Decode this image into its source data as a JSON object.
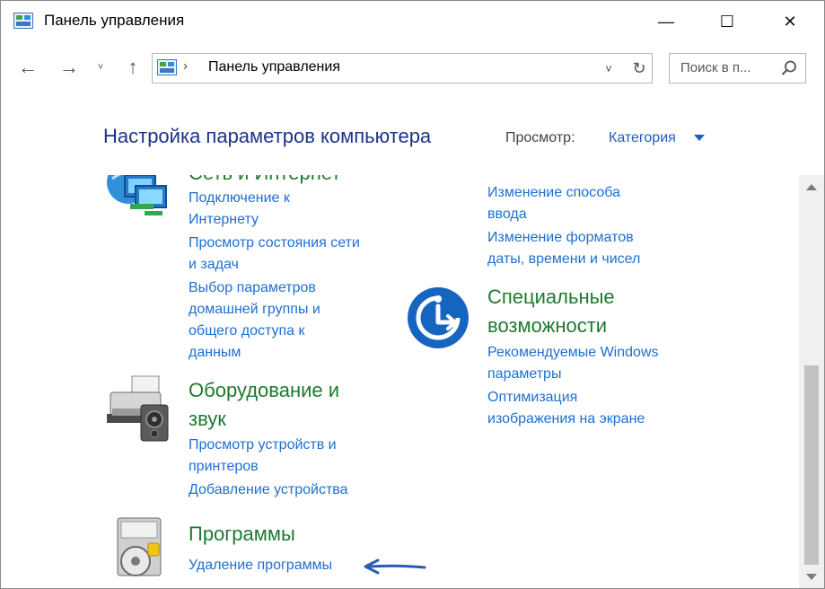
{
  "window": {
    "title": "Панель управления",
    "buttons": {
      "minimize": "—",
      "maximize": "☐",
      "close": "✕"
    }
  },
  "nav": {
    "back": "←",
    "forward": "→",
    "recent": "˅",
    "up": "↑",
    "address": "Панель управления",
    "address_chevron": "›",
    "address_dropdown": "˅",
    "refresh": "↻",
    "search_placeholder": "Поиск в п..."
  },
  "header": {
    "title": "Настройка параметров компьютера",
    "view_label": "Просмотр:",
    "view_value": "Категория"
  },
  "left": {
    "network": {
      "category": "Сеть и Интернет",
      "links": [
        "Подключение к",
        "Интернету",
        "Просмотр состояния сети",
        "и задач",
        "Выбор параметров",
        "домашней группы и",
        "общего доступа к",
        "данным"
      ]
    },
    "hardware": {
      "category_line1": "Оборудование и",
      "category_line2": "звук",
      "links": [
        "Просмотр устройств и",
        "принтеров",
        "Добавление устройства"
      ]
    },
    "programs": {
      "category": "Программы",
      "links": [
        "Удаление программы"
      ]
    }
  },
  "right": {
    "clock_links": [
      "Изменение способа",
      "ввода",
      "Изменение форматов",
      "даты, времени и чисел"
    ],
    "ease": {
      "category_line1": "Специальные",
      "category_line2": "возможности",
      "links": [
        "Рекомендуемые Windows",
        "параметры",
        "Оптимизация",
        "изображения на экране"
      ]
    }
  },
  "colors": {
    "link": "#1e6fd1",
    "category": "#1e7a2f",
    "heading": "#1e3287",
    "annotation_arrow": "#2a5bb5"
  }
}
